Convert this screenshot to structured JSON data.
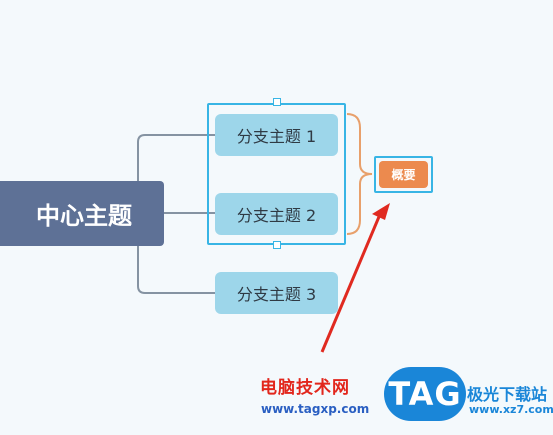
{
  "mindmap": {
    "central_topic": "中心主题",
    "branches": [
      {
        "label": "分支主题 1"
      },
      {
        "label": "分支主题 2"
      },
      {
        "label": "分支主题 3"
      }
    ],
    "summary": "概要"
  },
  "watermark": {
    "site_name": "电脑技术网",
    "site_url": "www.tagxp.com",
    "badge": "TAG",
    "site_name_2": "极光下载站",
    "site_url_2": "www.xz7.com"
  },
  "colors": {
    "central_fill": "#5e7196",
    "branch_fill": "#9dd6ea",
    "connector": "#8593a2",
    "selection": "#38b5e5",
    "summary_fill": "#ec8a4e",
    "summary_bracket": "#e8a06b",
    "annotation_arrow": "#e02a20"
  }
}
